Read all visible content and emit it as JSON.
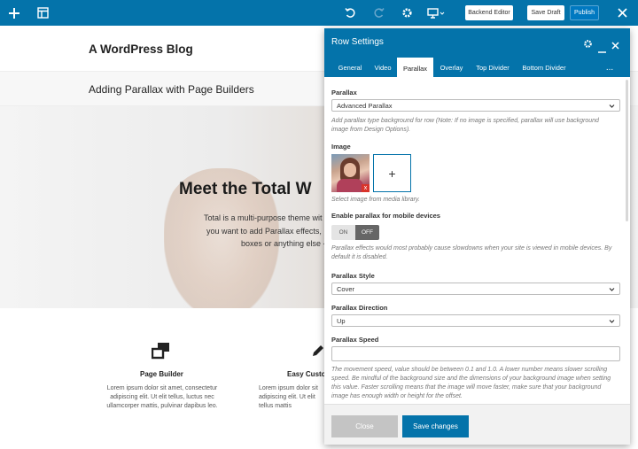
{
  "toolbar": {
    "backend_editor": "Backend Editor",
    "save_draft": "Save Draft",
    "publish": "Publish"
  },
  "page": {
    "blog_title": "A WordPress Blog",
    "post_title": "Adding Parallax with Page Builders",
    "hero_heading": "Meet the Total W",
    "hero_lines": [
      "Total is a multi-purpose theme wit",
      "you want to add Parallax effects,",
      "boxes or anything else -"
    ],
    "features": [
      {
        "title": "Page Builder",
        "text": "Lorem ipsum dolor sit amet, consectetur adipiscing elit. Ut elit tellus, luctus nec ullamcorper mattis, pulvinar dapibus leo."
      },
      {
        "title": "Easy Custor",
        "text": "Lorem ipsum dolor sit adipiscing elit. Ut elit tellus mattis"
      }
    ]
  },
  "panel": {
    "title": "Row Settings",
    "tabs": [
      "General",
      "Video",
      "Parallax",
      "Overlay",
      "Top Divider",
      "Bottom Divider"
    ],
    "more": "...",
    "parallax_label": "Parallax",
    "parallax_value": "Advanced Parallax",
    "parallax_help": "Add parallax type background for row (Note: If no image is specified, parallax will use background image from Design Options).",
    "image_label": "Image",
    "add_symbol": "+",
    "remove_symbol": "x",
    "image_help": "Select image from media library.",
    "mobile_label": "Enable parallax for mobile devices",
    "toggle_on": "ON",
    "toggle_off": "OFF",
    "mobile_help": "Parallax effects would most probably cause slowdowns when your site is viewed in mobile devices. By default it is disabled.",
    "style_label": "Parallax Style",
    "style_value": "Cover",
    "direction_label": "Parallax Direction",
    "direction_value": "Up",
    "speed_label": "Parallax Speed",
    "speed_value": "",
    "speed_help": "The movement speed, value should be between 0.1 and 1.0. A lower number means slower scrolling speed. Be mindful of the background size and the dimensions of your background image when setting this value. Faster scrolling means that the image will move faster, make sure that your background image has enough width or height for the offset.",
    "close": "Close",
    "save": "Save changes"
  }
}
